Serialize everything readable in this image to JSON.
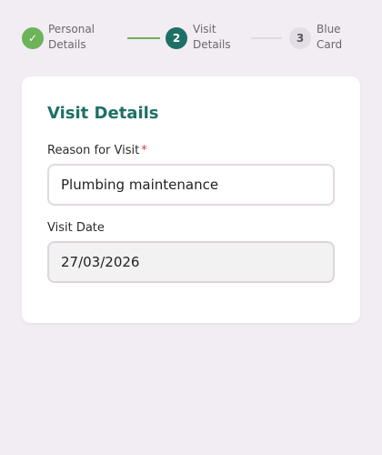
{
  "stepper": {
    "steps": [
      {
        "number": "✓",
        "line1": "Personal",
        "line2": "Details",
        "state": "done"
      },
      {
        "number": "2",
        "line1": "Visit",
        "line2": "Details",
        "state": "active"
      },
      {
        "number": "3",
        "line1": "Blue",
        "line2": "Card",
        "state": "pending"
      }
    ]
  },
  "form": {
    "title": "Visit Details",
    "reason_label": "Reason for Visit",
    "required_mark": "*",
    "reason_value": "Plumbing maintenance",
    "date_label": "Visit Date",
    "date_value": "27/03/2026"
  },
  "colors": {
    "done": "#6cb35a",
    "active": "#1e7066",
    "required": "#d43c3c"
  }
}
